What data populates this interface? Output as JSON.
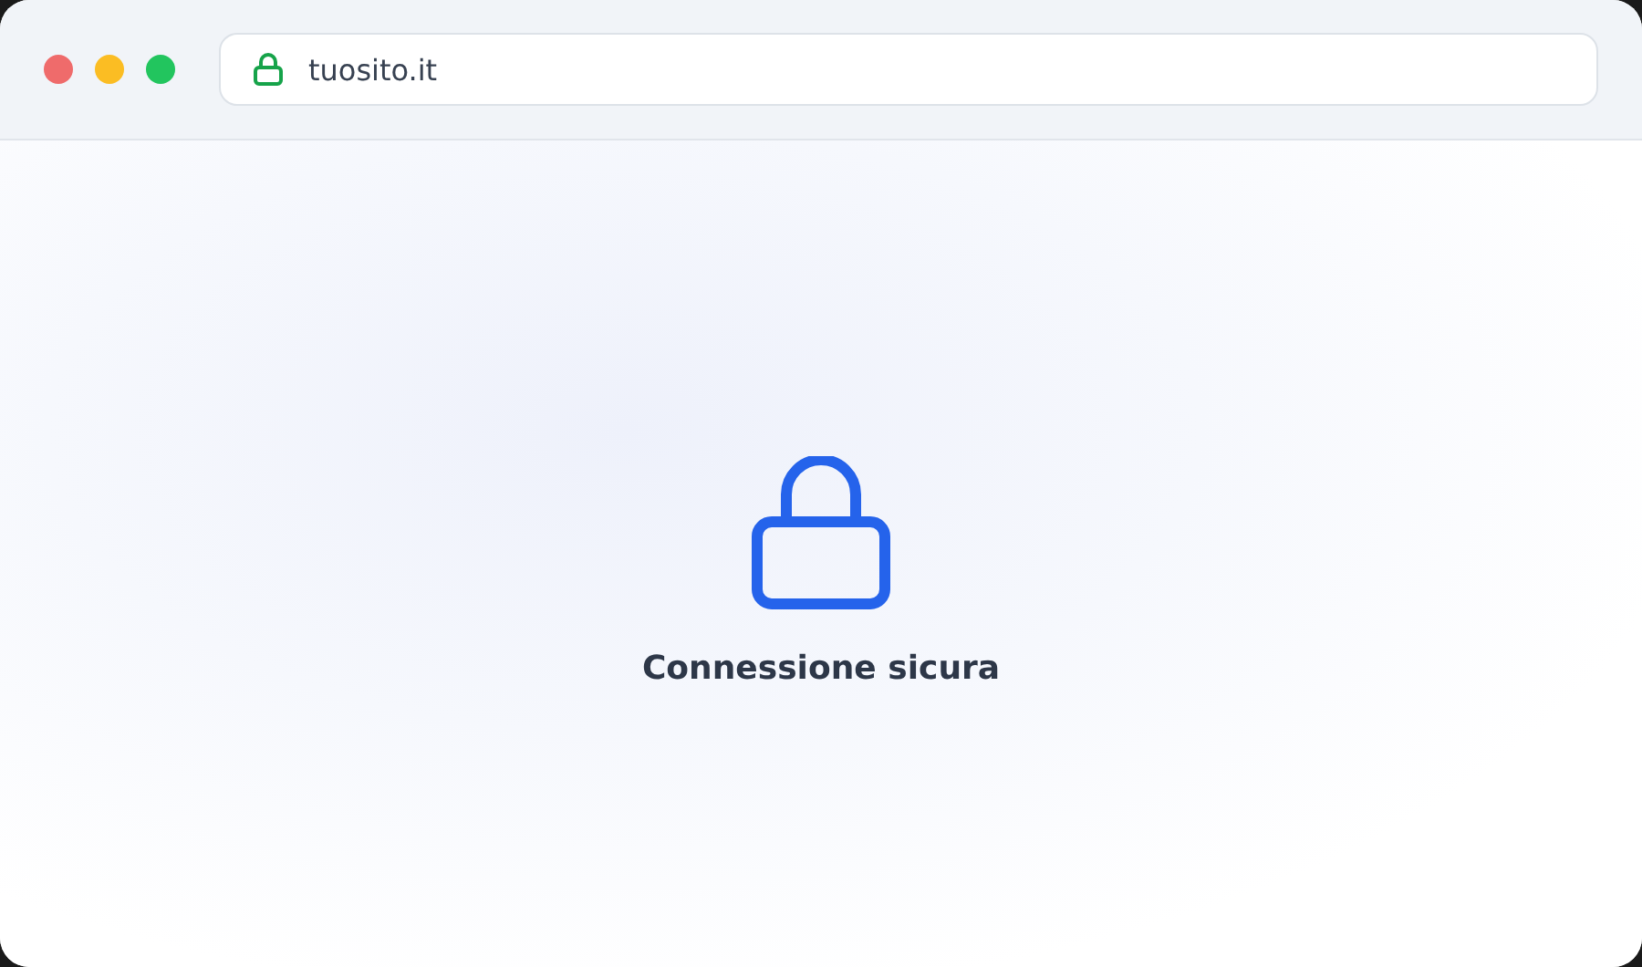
{
  "window_controls": [
    {
      "color": "#ef6b6b"
    },
    {
      "color": "#fbbd23"
    },
    {
      "color": "#22c55e"
    }
  ],
  "address_bar": {
    "url": "tuosito.it"
  },
  "content": {
    "message": "Connessione sicura"
  }
}
